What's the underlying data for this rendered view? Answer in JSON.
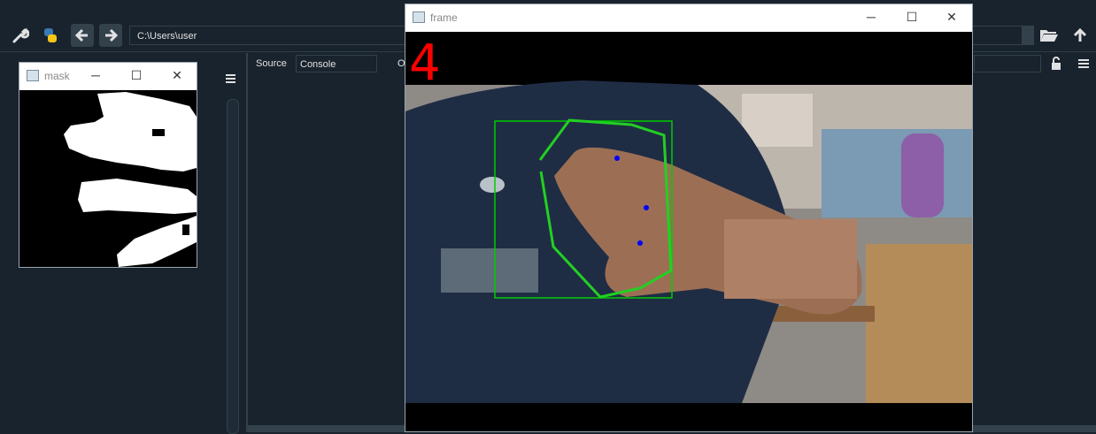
{
  "spyder": {
    "path": "C:\\Users\\user",
    "source_label": "Source",
    "console_option": "Console",
    "o_label": "O",
    "icons": [
      "wrench-icon",
      "python-icon",
      "arrow-left-icon",
      "arrow-right-icon",
      "folder-open-icon",
      "arrow-up-icon",
      "hamburger-icon",
      "lock-icon"
    ]
  },
  "mask_window": {
    "title": "mask",
    "controls": [
      "─",
      "☐",
      "✕"
    ]
  },
  "frame_window": {
    "title": "frame",
    "controls": [
      "─",
      "☐",
      "✕"
    ],
    "finger_count": "4",
    "colors": {
      "count": "#ff0000",
      "bbox": "#00cc00",
      "hull": "#22d022",
      "defect": "#0000ff"
    }
  }
}
